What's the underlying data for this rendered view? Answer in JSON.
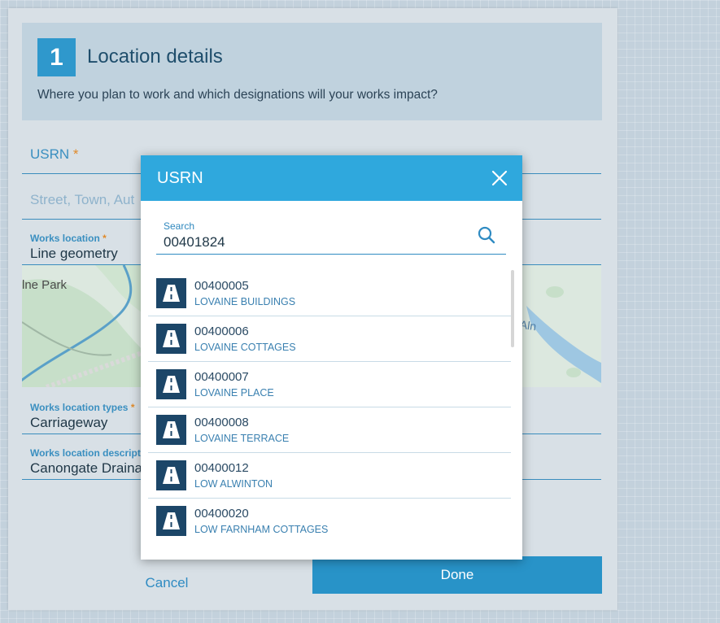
{
  "header": {
    "step": "1",
    "title": "Location details",
    "subtitle": "Where you plan to work and which designations will your works impact?"
  },
  "form": {
    "usrn_label": "USRN",
    "required_mark": "*",
    "street_placeholder": "Street, Town, Aut",
    "works_location_label": "Works location",
    "works_location_value": "Line geometry",
    "works_location_types_label": "Works location types",
    "works_location_types_value": "Carriageway",
    "works_location_description_label": "Works location descripti",
    "works_location_description_value": "Canongate Draina"
  },
  "map": {
    "park_label": "lne Park",
    "river_label": "Aln"
  },
  "footer": {
    "cancel_label": "Cancel",
    "done_label": "Done"
  },
  "dialog": {
    "title": "USRN",
    "search_label": "Search",
    "search_value": "00401824",
    "results": [
      {
        "usrn": "00400005",
        "name": "LOVAINE BUILDINGS"
      },
      {
        "usrn": "00400006",
        "name": "LOVAINE COTTAGES"
      },
      {
        "usrn": "00400007",
        "name": "LOVAINE PLACE"
      },
      {
        "usrn": "00400008",
        "name": "LOVAINE TERRACE"
      },
      {
        "usrn": "00400012",
        "name": "LOW ALWINTON"
      },
      {
        "usrn": "00400020",
        "name": "LOW FARNHAM COTTAGES"
      }
    ]
  },
  "colors": {
    "accent": "#2fa8dd",
    "primary_button": "#2893c8",
    "required": "#e08a2a",
    "row_icon_bg": "#1c4668"
  }
}
